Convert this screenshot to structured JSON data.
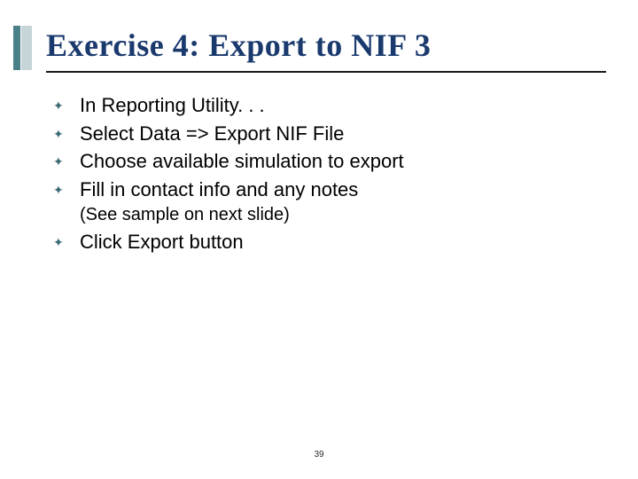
{
  "title": "Exercise 4: Export to NIF 3",
  "bullets": [
    "In Reporting Utility. . .",
    "Select Data => Export NIF File",
    "Choose available simulation to export",
    "Fill in contact info and any notes"
  ],
  "sub_note": "(See sample on next slide)",
  "bullet_after": "Click Export button",
  "page_number": "39"
}
